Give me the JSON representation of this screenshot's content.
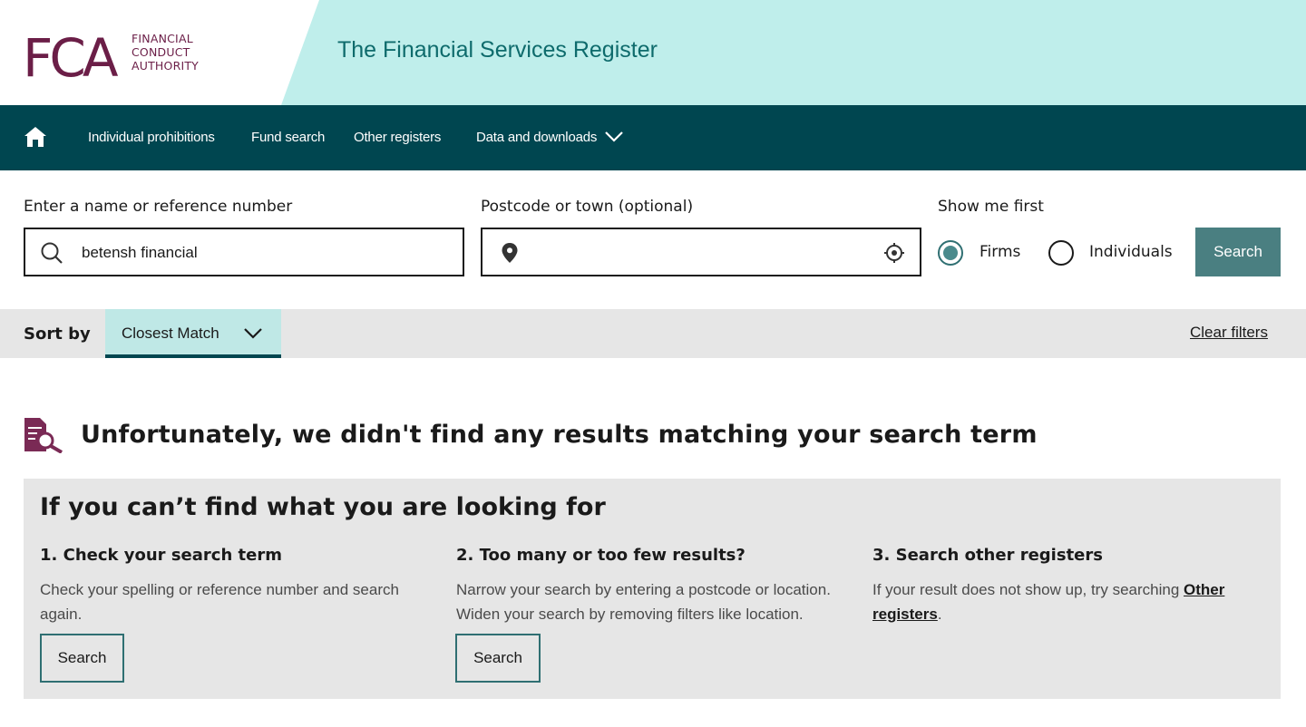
{
  "header": {
    "logo_letters": "FCA",
    "logo_lines": [
      "FINANCIAL",
      "CONDUCT",
      "AUTHORITY"
    ],
    "site_title": "The Financial Services Register"
  },
  "nav": {
    "items": [
      {
        "label": "Individual prohibitions"
      },
      {
        "label": "Fund search"
      },
      {
        "label": "Other registers"
      },
      {
        "label": "Data and downloads"
      }
    ]
  },
  "search": {
    "name_label": "Enter a name or reference number",
    "name_value": "betensh financial",
    "postcode_label": "Postcode or town (optional)",
    "postcode_value": "",
    "show_first_label": "Show me first",
    "options": [
      {
        "label": "Firms",
        "checked": true
      },
      {
        "label": "Individuals",
        "checked": false
      }
    ],
    "button_label": "Search"
  },
  "sort": {
    "label": "Sort by",
    "selected": "Closest Match",
    "clear_label": "Clear filters"
  },
  "no_results": {
    "heading": "Unfortunately, we didn't find any results matching your search term"
  },
  "help": {
    "title": "If you can’t find what you are looking for",
    "columns": [
      {
        "title": "1. Check your search term",
        "text": "Check your spelling or reference number and search again.",
        "button": "Search"
      },
      {
        "title": "2. Too many or too few results?",
        "text_line1": "Narrow your search by entering a postcode or location.",
        "text_line2": "Widen your search by removing filters like location.",
        "button": "Search"
      },
      {
        "title": "3. Search other registers",
        "text_before": "If your result does not show up, try searching ",
        "link": "Other registers",
        "text_after": "."
      }
    ]
  },
  "colors": {
    "brand_purple": "#6b1e47",
    "header_mint": "#bfeeeb",
    "nav_teal": "#004650",
    "button_teal": "#4a7f81",
    "panel_grey": "#e6e6e6"
  }
}
